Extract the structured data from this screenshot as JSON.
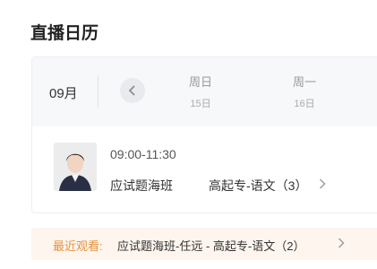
{
  "page": {
    "title": "直播日历"
  },
  "calendar": {
    "month": "09月",
    "days": [
      {
        "weekday": "周日",
        "date": "15日"
      },
      {
        "weekday": "周一",
        "date": "16日"
      }
    ]
  },
  "session": {
    "time": "09:00-11:30",
    "class_name": "应试题海班",
    "course": "高起专-语文（3）"
  },
  "recent": {
    "label": "最近观看:",
    "text": "应试题海班-任远  -  高起专-语文（2）"
  },
  "colors": {
    "accent": "#e8913c",
    "recent_bg": "#fdf5ee",
    "header_bg": "#f7f8fa"
  },
  "icons": {
    "prev": "chevron-left-icon",
    "row": "chevron-right-icon",
    "recent": "chevron-right-icon"
  }
}
